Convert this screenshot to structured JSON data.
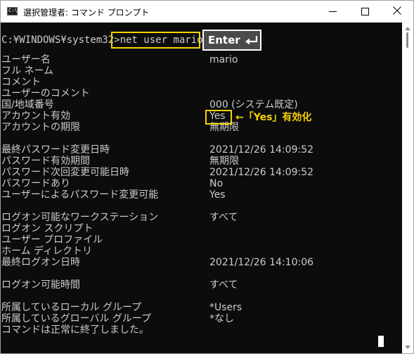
{
  "window": {
    "title": "選択管理者: コマンド プロンプト",
    "icon": "cmd-icon",
    "icon_glyph": "C:\\",
    "controls": [
      "minimize-icon",
      "maximize-icon",
      "close-icon"
    ]
  },
  "terminal": {
    "prompt": "C:¥WINDOWS¥system32>",
    "command": "net user mario",
    "enter_key_label": "Enter",
    "enter_key_icon": "return-arrow-icon",
    "rows": [
      {
        "label": "ユーザー名",
        "value": "mario"
      },
      {
        "label": "フル ネーム",
        "value": ""
      },
      {
        "label": "コメント",
        "value": ""
      },
      {
        "label": "ユーザーのコメント",
        "value": ""
      },
      {
        "label": "国/地域番号",
        "value": "000 (システム既定)"
      },
      {
        "label": "アカウント有効",
        "value": "Yes"
      },
      {
        "label": "アカウントの期限",
        "value": "無期限"
      },
      {
        "label": "",
        "value": ""
      },
      {
        "label": "最終パスワード変更日時",
        "value": "2021/12/26 14:09:52"
      },
      {
        "label": "パスワード有効期間",
        "value": "無期限"
      },
      {
        "label": "パスワード次回変更可能日時",
        "value": "2021/12/26 14:09:52"
      },
      {
        "label": "パスワードあり",
        "value": "No"
      },
      {
        "label": "ユーザーによるパスワード変更可能",
        "value": "Yes"
      },
      {
        "label": "",
        "value": ""
      },
      {
        "label": "ログオン可能なワークステーション",
        "value": "すべて"
      },
      {
        "label": "ログオン スクリプト",
        "value": ""
      },
      {
        "label": "ユーザー プロファイル",
        "value": ""
      },
      {
        "label": "ホーム ディレクトリ",
        "value": ""
      },
      {
        "label": "最終ログオン日時",
        "value": "2021/12/26 14:10:06"
      },
      {
        "label": "",
        "value": ""
      },
      {
        "label": "ログオン可能時間",
        "value": "すべて"
      },
      {
        "label": "",
        "value": ""
      },
      {
        "label": "所属しているローカル グループ",
        "value": "*Users"
      },
      {
        "label": "所属しているグローバル グループ",
        "value": "*なし"
      },
      {
        "label": "コマンドは正常に終了しました。",
        "value": ""
      }
    ],
    "annotation": "←「Yes」有効化"
  },
  "colors": {
    "terminal_bg": "#0c0c0c",
    "terminal_text": "#cccccc",
    "highlight": "#f5d300",
    "enter_key_bg": "#4a4a4a"
  }
}
